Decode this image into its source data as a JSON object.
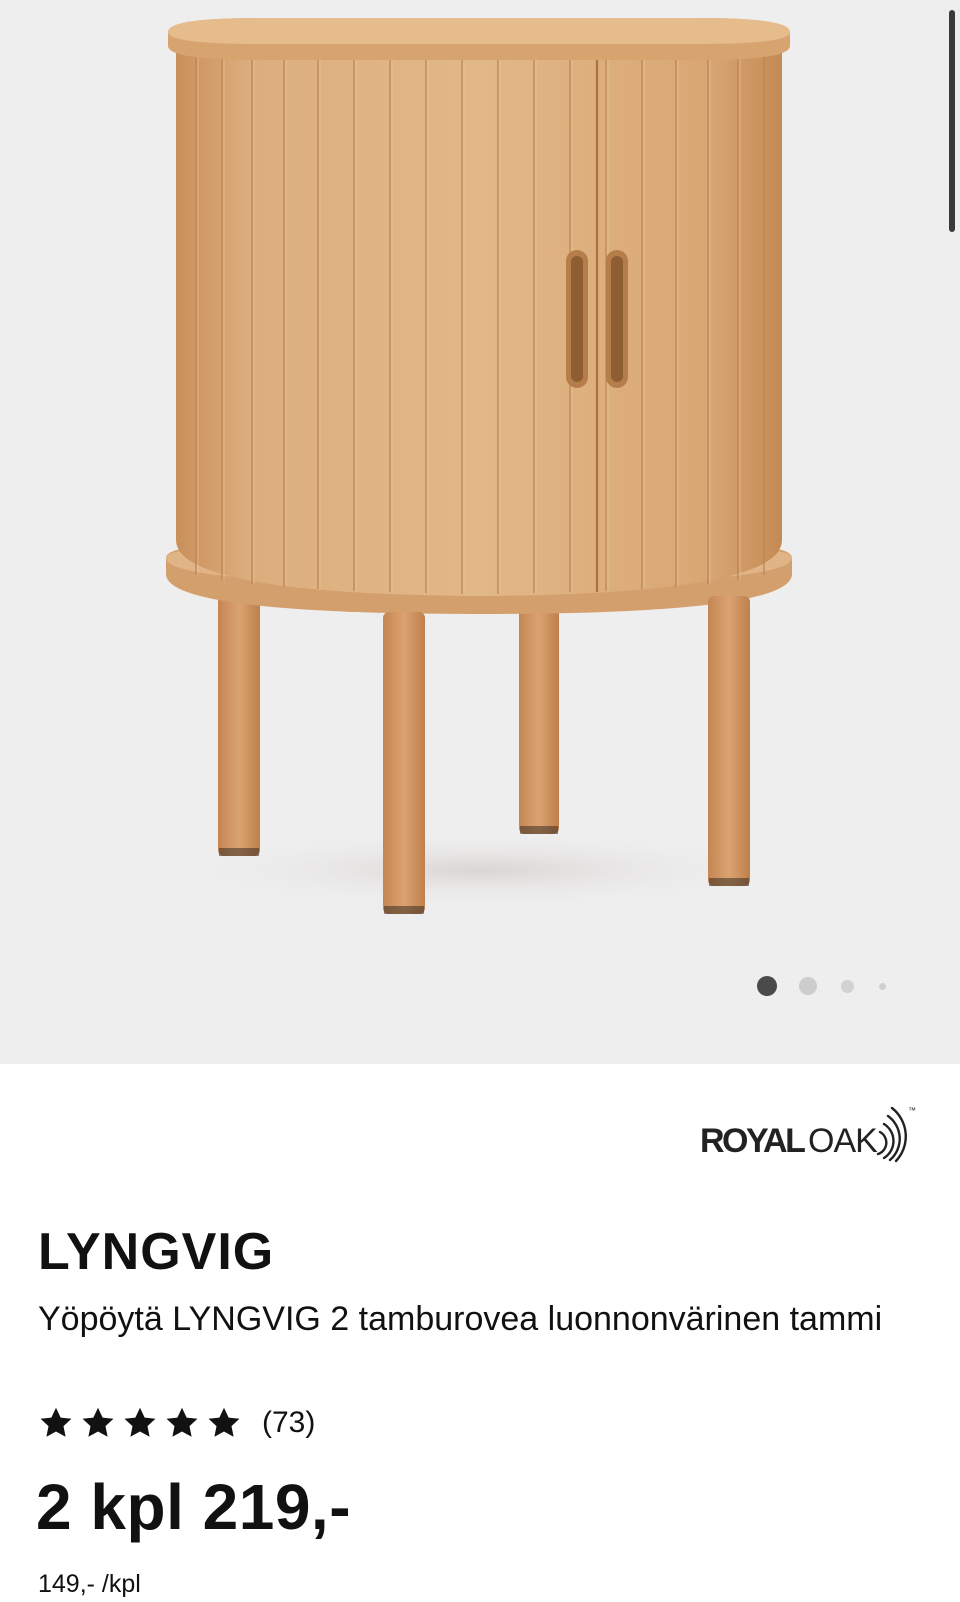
{
  "gallery": {
    "image_alt": "Yöpöytä LYNGVIG",
    "page_dots": [
      {
        "active": true
      },
      {
        "active": false
      },
      {
        "active": false
      },
      {
        "active": false
      }
    ]
  },
  "brand": {
    "part1": "ROYAL",
    "part2": "OAK",
    "trademark": "™"
  },
  "product": {
    "name": "LYNGVIG",
    "description": "Yöpöytä LYNGVIG 2 tamburovea luonnonvärinen tammi",
    "rating": {
      "stars": 5,
      "max_stars": 5,
      "review_count": "(73)"
    },
    "price": "2 kpl 219,-",
    "unit_price": "149,- /kpl"
  },
  "colors": {
    "gallery_bg": "#efeeee",
    "wood_light": "#dcae7d",
    "wood_dark": "#c8915c",
    "text": "#111111"
  },
  "icons": {
    "star": "star-icon",
    "logo_arcs": "signal-arcs-icon"
  }
}
